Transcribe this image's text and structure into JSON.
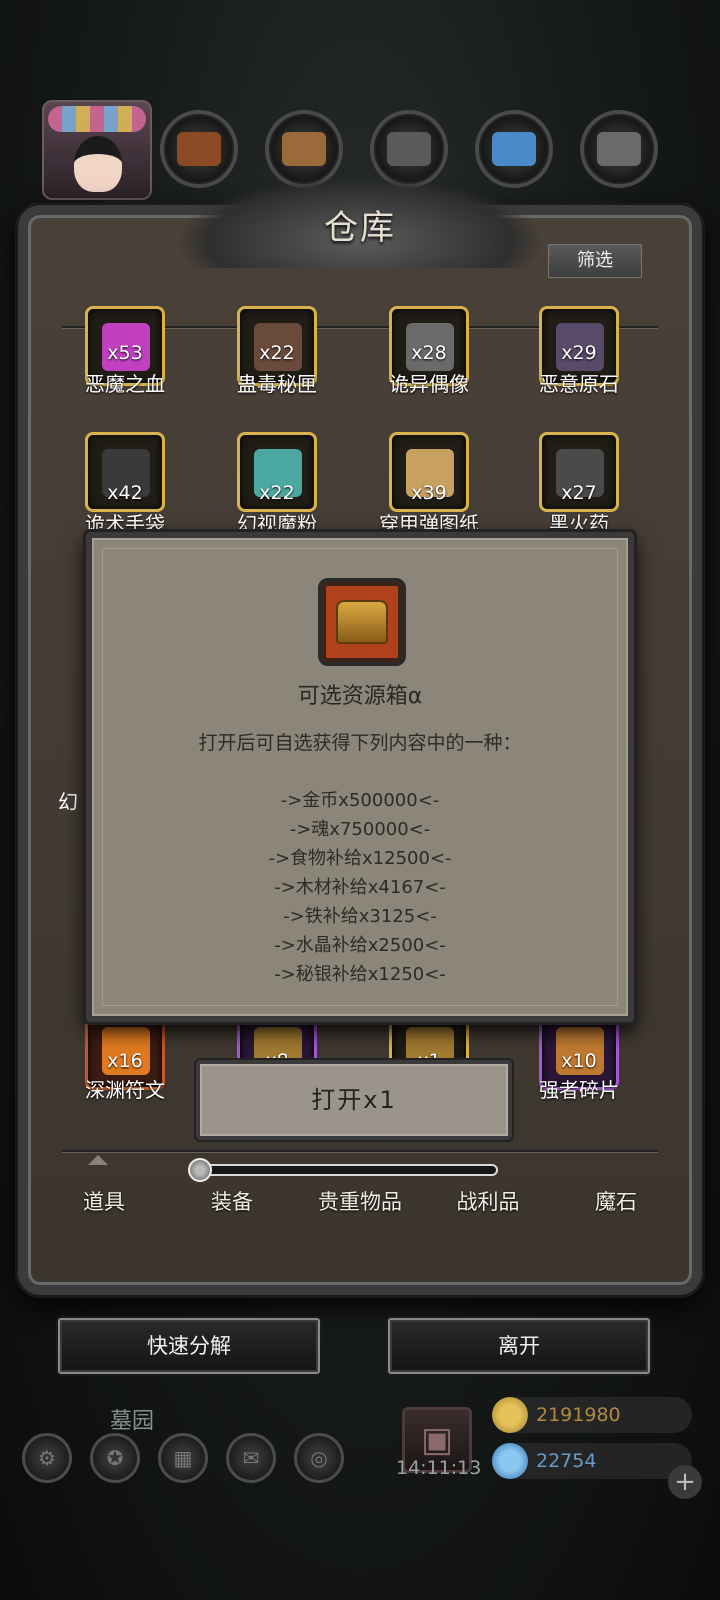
{
  "scene": {
    "resources": [
      {
        "icon": "food-resource-icon",
        "color": "#8a4a24"
      },
      {
        "icon": "wood-resource-icon",
        "color": "#9a6a3a"
      },
      {
        "icon": "iron-resource-icon",
        "color": "#5a5a5a"
      },
      {
        "icon": "crystal-resource-icon",
        "color": "#4a8ac8"
      },
      {
        "icon": "mithril-resource-icon",
        "color": "#6a6a6a"
      }
    ],
    "location_label": "墓园",
    "clock": "14:11:13",
    "gold": "2191980",
    "gems": "22754"
  },
  "warehouse": {
    "title": "仓库",
    "filter_label": "筛选",
    "items_row1": [
      {
        "qty": "x53",
        "name": "恶魔之血",
        "rarity": "gold",
        "color": "#c040c0"
      },
      {
        "qty": "x22",
        "name": "蛊毒秘匣",
        "rarity": "gold",
        "color": "#6a4a3a"
      },
      {
        "qty": "x28",
        "name": "诡异偶像",
        "rarity": "gold",
        "color": "#6a6a6a"
      },
      {
        "qty": "x29",
        "name": "恶意原石",
        "rarity": "gold",
        "color": "#5a4a6a"
      }
    ],
    "items_row2": [
      {
        "qty": "x42",
        "name": "诡术手袋",
        "rarity": "gold",
        "color": "#3a3a3a"
      },
      {
        "qty": "x22",
        "name": "幻视魔粉",
        "rarity": "gold",
        "color": "#4aa8a0"
      },
      {
        "qty": "x39",
        "name": "穿甲弹图纸",
        "rarity": "gold",
        "color": "#c8a060"
      },
      {
        "qty": "x27",
        "name": "黑火药",
        "rarity": "gold",
        "color": "#4a4a4a"
      }
    ],
    "items_row3": [
      {
        "qty": "x16",
        "name": "深渊符文",
        "rarity": "red",
        "color": "#e07a20"
      },
      {
        "qty": "x8",
        "name": "",
        "rarity": "purple",
        "color": "#a07a30"
      },
      {
        "qty": "x1",
        "name": "",
        "rarity": "gold",
        "color": "#a07a30"
      },
      {
        "qty": "x10",
        "name": "强者碎片",
        "rarity": "purple",
        "color": "#c07a30"
      }
    ],
    "partial_left_label": "幻",
    "open_button": "打开x1",
    "tabs": [
      "道具",
      "装备",
      "贵重物品",
      "战利品",
      "魔石"
    ],
    "quick_decompose": "快速分解",
    "leave": "离开"
  },
  "popup": {
    "item_name": "可选资源箱α",
    "description": "打开后可自选获得下列内容中的一种：",
    "options": [
      "->金币x500000<-",
      "->魂x750000<-",
      "->食物补给x12500<-",
      "->木材补给x4167<-",
      "->铁补给x3125<-",
      "->水晶补给x2500<-",
      "->秘银补给x1250<-"
    ]
  },
  "colors": {
    "gold_border": "#d8b24a",
    "purple_border": "#a45ad6",
    "popup_bg": "#8c857a"
  }
}
